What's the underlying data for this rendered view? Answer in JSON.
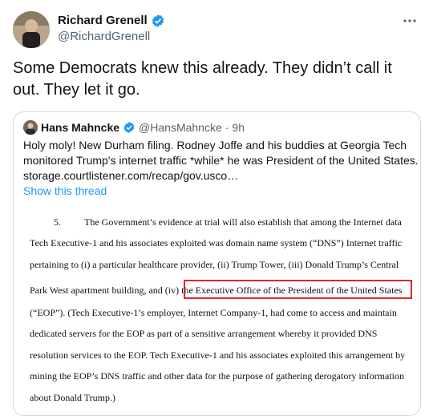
{
  "tweet": {
    "author_name": "Richard Grenell",
    "author_handle": "@RichardGrenell",
    "text_lines": [
      "Some Democrats knew this already. They didn’t call it",
      "out. They let it go."
    ],
    "more_icon": "ellipsis-icon",
    "verified_icon": "verified-badge-icon"
  },
  "quote": {
    "author_name": "Hans Mahncke",
    "author_handle": "@HansMahncke",
    "separator": "·",
    "time": "9h",
    "text_lines": [
      "Holy moly! New Durham filing. Rodney Joffe and his buddies at Georgia Tech",
      "monitored Trump's internet traffic *while* he was President of the United States.",
      "storage.courtlistener.com/recap/gov.usco…"
    ],
    "show_thread": "Show this thread"
  },
  "document": {
    "paragraph_number": "5.",
    "lines": [
      "The Government’s evidence at trial will also establish that among the Internet data",
      "Tech Executive-1 and his associates exploited was domain name system (“DNS”) Internet traffic",
      "pertaining to (i) a particular healthcare provider, (ii) Trump Tower, (iii) Donald Trump’s Central",
      "Park West apartment building, and (iv) the Executive Office of the President of the United States",
      "(“EOP”).  (Tech Executive-1’s employer, Internet Company-1, had come to access and maintain",
      "dedicated servers for the EOP as part of a sensitive arrangement whereby it provided DNS",
      "resolution services to the EOP.  Tech Executive-1 and his associates exploited this arrangement by",
      "mining the EOP’s DNS traffic and other data for the purpose of gathering derogatory information",
      "about Donald Trump.)"
    ],
    "highlight_color": "#e0262f"
  }
}
